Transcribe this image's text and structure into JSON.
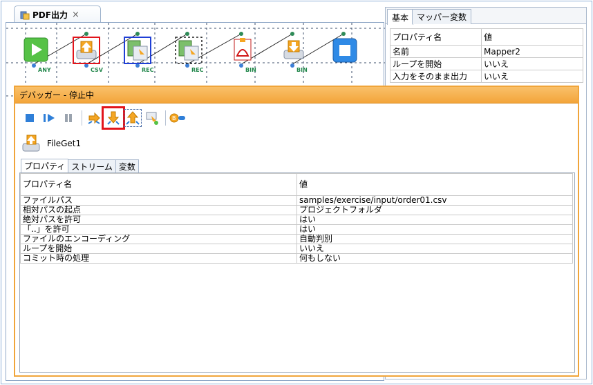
{
  "editor": {
    "tab_title": "PDF出力",
    "close_glyph": "×",
    "flow_labels": [
      "ANY",
      "CSV",
      "REC",
      "REC",
      "BIN",
      "BIN"
    ]
  },
  "right_panel": {
    "tabs": [
      "基本",
      "マッパー変数"
    ],
    "columns": [
      "プロパティ名",
      "値"
    ],
    "rows": [
      {
        "name": "名前",
        "value": "Mapper2"
      },
      {
        "name": "ループを開始",
        "value": "いいえ"
      },
      {
        "name": "入力をそのまま出力",
        "value": "いいえ"
      }
    ]
  },
  "debugger": {
    "title": "デバッガー - 停止中",
    "component_name": "FileGet1",
    "tabs": [
      "プロパティ",
      "ストリーム",
      "変数"
    ],
    "columns": [
      "プロパティ名",
      "値"
    ],
    "rows": [
      {
        "name": "ファイルパス",
        "value": "samples/exercise/input/order01.csv"
      },
      {
        "name": "相対パスの起点",
        "value": "プロジェクトフォルダ"
      },
      {
        "name": "絶対パスを許可",
        "value": "はい"
      },
      {
        "name": "「..」を許可",
        "value": "はい"
      },
      {
        "name": "ファイルのエンコーディング",
        "value": "自動判別"
      },
      {
        "name": "ループを開始",
        "value": "いいえ"
      },
      {
        "name": "コミット時の処理",
        "value": "何もしない"
      }
    ]
  },
  "colors": {
    "accent_orange": "#f3a53a",
    "highlight_red": "#e2141b",
    "flow_green": "#20864a"
  }
}
